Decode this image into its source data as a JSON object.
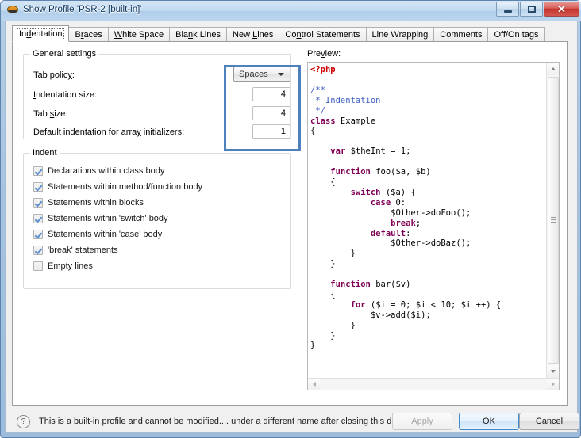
{
  "window": {
    "title": "Show Profile 'PSR-2 [built-in]'",
    "icon": "php-profile-icon",
    "minimize_label": "",
    "maximize_label": "",
    "close_label": "✕"
  },
  "tabs": [
    {
      "label": "Indentation",
      "selected": true
    },
    {
      "label": "Braces",
      "selected": false
    },
    {
      "label": "White Space",
      "selected": false
    },
    {
      "label": "Blank Lines",
      "selected": false
    },
    {
      "label": "New Lines",
      "selected": false
    },
    {
      "label": "Control Statements",
      "selected": false
    },
    {
      "label": "Line Wrapping",
      "selected": false
    },
    {
      "label": "Comments",
      "selected": false
    },
    {
      "label": "Off/On tags",
      "selected": false
    }
  ],
  "general_settings": {
    "group_title": "General settings",
    "tab_policy_label": "Tab policy:",
    "tab_policy_value": "Spaces",
    "indentation_size_label": "Indentation size:",
    "indentation_size_value": "4",
    "tab_size_label": "Tab size:",
    "tab_size_value": "4",
    "array_initializers_label": "Default indentation for array initializers:",
    "array_initializers_value": "1"
  },
  "highlight": {
    "color": "#4f81bd"
  },
  "indent_group": {
    "group_title": "Indent",
    "items": [
      {
        "label": "Declarations within class body",
        "checked": true
      },
      {
        "label": "Statements within method/function body",
        "checked": true
      },
      {
        "label": "Statements within blocks",
        "checked": true
      },
      {
        "label": "Statements within 'switch' body",
        "checked": true
      },
      {
        "label": "Statements within 'case' body",
        "checked": true
      },
      {
        "label": "'break' statements",
        "checked": true
      },
      {
        "label": "Empty lines",
        "checked": false
      }
    ]
  },
  "preview": {
    "label": "Preview:",
    "language": "php",
    "colors": {
      "tag": "#cc0000",
      "comment": "#3f5fbf",
      "keyword": "#7f0055",
      "plain": "#000000"
    },
    "code_lines": [
      {
        "segments": [
          {
            "t": "<?php",
            "c": "tag"
          }
        ]
      },
      {
        "segments": []
      },
      {
        "segments": [
          {
            "t": "/**",
            "c": "com"
          }
        ]
      },
      {
        "segments": [
          {
            "t": " * Indentation",
            "c": "com"
          }
        ]
      },
      {
        "segments": [
          {
            "t": " */",
            "c": "com"
          }
        ]
      },
      {
        "segments": [
          {
            "t": "class",
            "c": "kw"
          },
          {
            "t": " Example",
            "c": "pln"
          }
        ]
      },
      {
        "segments": [
          {
            "t": "{",
            "c": "pln"
          }
        ]
      },
      {
        "segments": []
      },
      {
        "segments": [
          {
            "t": "    ",
            "c": "pln"
          },
          {
            "t": "var",
            "c": "kw"
          },
          {
            "t": " $theInt = 1;",
            "c": "pln"
          }
        ]
      },
      {
        "segments": []
      },
      {
        "segments": [
          {
            "t": "    ",
            "c": "pln"
          },
          {
            "t": "function",
            "c": "kw"
          },
          {
            "t": " foo($a, $b)",
            "c": "pln"
          }
        ]
      },
      {
        "segments": [
          {
            "t": "    {",
            "c": "pln"
          }
        ]
      },
      {
        "segments": [
          {
            "t": "        ",
            "c": "pln"
          },
          {
            "t": "switch",
            "c": "kw"
          },
          {
            "t": " ($a) {",
            "c": "pln"
          }
        ]
      },
      {
        "segments": [
          {
            "t": "            ",
            "c": "pln"
          },
          {
            "t": "case",
            "c": "kw"
          },
          {
            "t": " 0:",
            "c": "pln"
          }
        ]
      },
      {
        "segments": [
          {
            "t": "                $Other->doFoo();",
            "c": "pln"
          }
        ]
      },
      {
        "segments": [
          {
            "t": "                ",
            "c": "pln"
          },
          {
            "t": "break",
            "c": "kw"
          },
          {
            "t": ";",
            "c": "pln"
          }
        ]
      },
      {
        "segments": [
          {
            "t": "            ",
            "c": "pln"
          },
          {
            "t": "default",
            "c": "kw"
          },
          {
            "t": ":",
            "c": "pln"
          }
        ]
      },
      {
        "segments": [
          {
            "t": "                $Other->doBaz();",
            "c": "pln"
          }
        ]
      },
      {
        "segments": [
          {
            "t": "        }",
            "c": "pln"
          }
        ]
      },
      {
        "segments": [
          {
            "t": "    }",
            "c": "pln"
          }
        ]
      },
      {
        "segments": []
      },
      {
        "segments": [
          {
            "t": "    ",
            "c": "pln"
          },
          {
            "t": "function",
            "c": "kw"
          },
          {
            "t": " bar($v)",
            "c": "pln"
          }
        ]
      },
      {
        "segments": [
          {
            "t": "    {",
            "c": "pln"
          }
        ]
      },
      {
        "segments": [
          {
            "t": "        ",
            "c": "pln"
          },
          {
            "t": "for",
            "c": "kw"
          },
          {
            "t": " ($i = 0; $i < 10; $i ++) {",
            "c": "pln"
          }
        ]
      },
      {
        "segments": [
          {
            "t": "            $v->add($i);",
            "c": "pln"
          }
        ]
      },
      {
        "segments": [
          {
            "t": "        }",
            "c": "pln"
          }
        ]
      },
      {
        "segments": [
          {
            "t": "    }",
            "c": "pln"
          }
        ]
      },
      {
        "segments": [
          {
            "t": "}",
            "c": "pln"
          }
        ]
      }
    ]
  },
  "bottom": {
    "help_icon": "?",
    "status_text": "This is a built-in profile and cannot be modified.... under a different name after closing this dialog.",
    "apply_label": "Apply",
    "apply_enabled": false,
    "ok_label": "OK",
    "cancel_label": "Cancel"
  }
}
